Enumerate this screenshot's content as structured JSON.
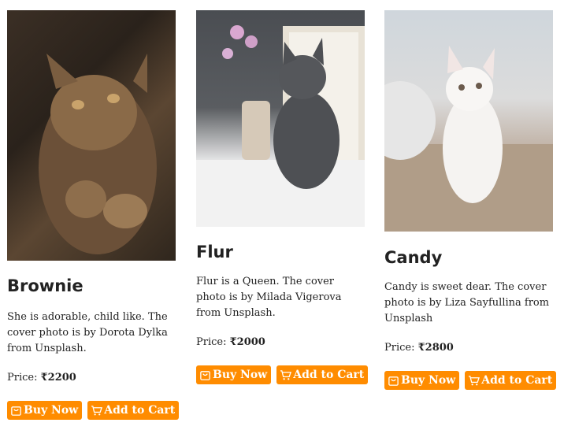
{
  "cards": [
    {
      "title": "Brownie",
      "description": "She is adorable, child like. The cover photo is by Dorota Dylka from Unsplash.",
      "price_label": "Price:",
      "price_value": "₹2200",
      "buy_label": "Buy Now",
      "cart_label": "Add to Cart"
    },
    {
      "title": "Flur",
      "description": "Flur is a Queen. The cover photo is by Milada Vigerova from Unsplash.",
      "price_label": "Price:",
      "price_value": "₹2000",
      "buy_label": "Buy Now",
      "cart_label": "Add to Cart"
    },
    {
      "title": "Candy",
      "description": "Candy is sweet dear. The cover photo is by Liza Sayfullina from Unsplash",
      "price_label": "Price:",
      "price_value": "₹2800",
      "buy_label": "Buy Now",
      "cart_label": "Add to Cart"
    }
  ],
  "colors": {
    "button": "#ff8c00",
    "button_text": "#ffffff"
  },
  "icons": {
    "buy": "shopping-bag-icon",
    "cart": "cart-icon"
  }
}
